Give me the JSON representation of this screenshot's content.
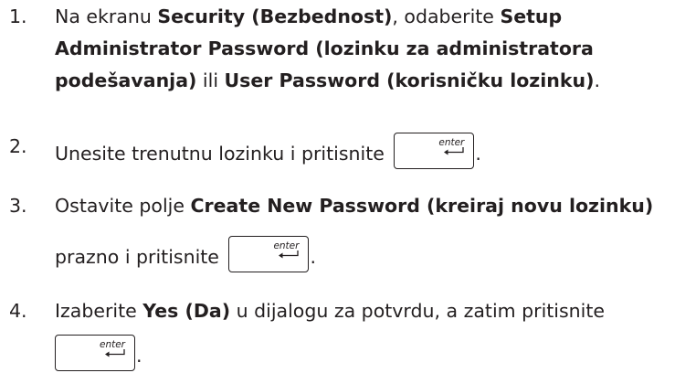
{
  "steps": [
    {
      "number": "1.",
      "lines": [
        [
          "Na ekranu ",
          "Security (Bezbednost)",
          ", odaberite ",
          "Setup"
        ],
        [
          "Administrator Password (lozinku za administratora"
        ],
        [
          "podešavanja)",
          " ili ",
          "User Password (korisničku lozinku)",
          "."
        ]
      ]
    },
    {
      "number": "2.",
      "text": "Unesite trenutnu lozinku i pritisnite",
      "after_key": "."
    },
    {
      "number": "3.",
      "text_a": "Ostavite polje ",
      "bold": "Create New Password (kreiraj novu lozinku)",
      "text_b": "prazno i pritisnite",
      "after_key": "."
    },
    {
      "number": "4.",
      "text_a": "Izaberite ",
      "bold": "Yes (Da)",
      "text_b": " u dijalogu za potvrdu, a zatim pritisnite",
      "after_key": "."
    }
  ],
  "key": {
    "label": "enter",
    "icon": "enter-arrow-icon"
  }
}
